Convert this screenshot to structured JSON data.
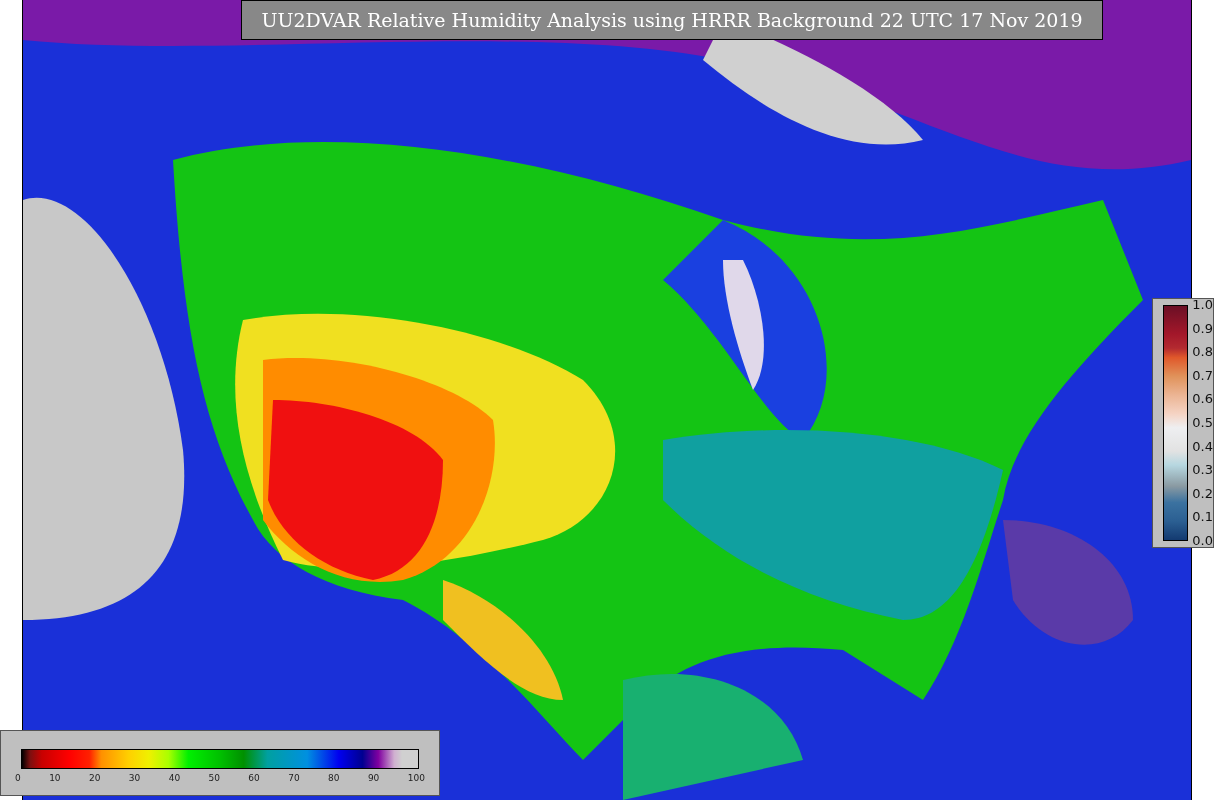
{
  "title": "UU2DVAR Relative Humidity Analysis using HRRR Background 22 UTC 17 Nov 2019",
  "observation_legend": {
    "ticks": [
      "1.0",
      "0.9",
      "0.8",
      "0.7",
      "0.6",
      "0.5",
      "0.4",
      "0.3",
      "0.2",
      "0.1",
      "0.0"
    ]
  },
  "humidity_legend": {
    "ticks": [
      "0",
      "10",
      "20",
      "30",
      "40",
      "50",
      "60",
      "70",
      "80",
      "90",
      "100"
    ]
  }
}
